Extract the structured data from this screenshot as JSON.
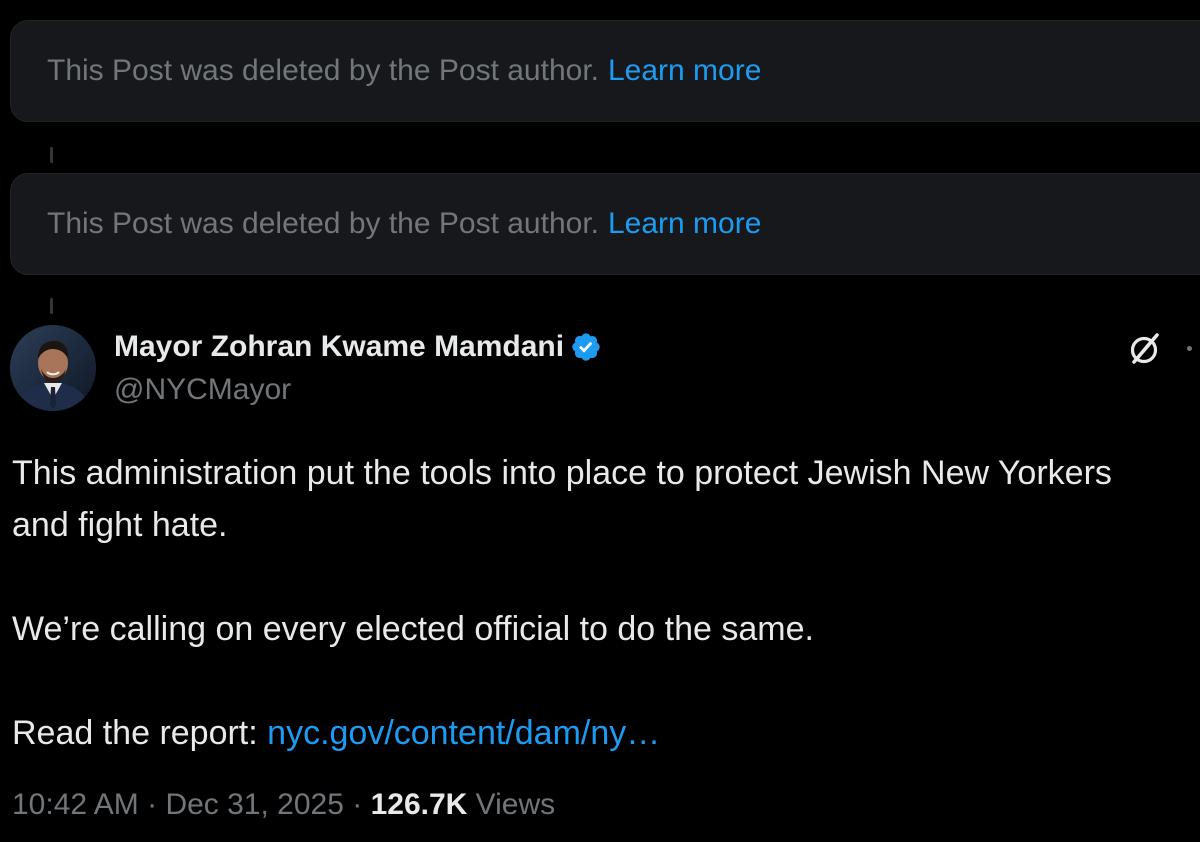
{
  "deleted_posts": [
    {
      "message": "This Post was deleted by the Post author.",
      "link": "Learn more"
    },
    {
      "message": "This Post was deleted by the Post author.",
      "link": "Learn more"
    }
  ],
  "post": {
    "author_name": "Mayor Zohran Kwame Mamdani",
    "handle": "@NYCMayor",
    "verified": true,
    "paragraph_1": "This administration put the tools into place to protect Jewish New Yorkers and fight hate.",
    "paragraph_2": "We’re calling on every elected official to do the same.",
    "paragraph_3_prefix": "Read the report: ",
    "paragraph_3_link": "nyc.gov/content/dam/ny…",
    "time": "10:42 AM",
    "date": "Dec 31, 2025",
    "separator": " · ",
    "views_count": "126.7K",
    "views_label": "Views"
  },
  "icons": {
    "verified": "verified-badge-icon",
    "grok": "grok-icon",
    "more": "more-icon"
  },
  "colors": {
    "background": "#000000",
    "card": "#16181c",
    "text_primary": "#e7e9ea",
    "text_secondary": "#71767b",
    "accent": "#1d9bf0"
  }
}
